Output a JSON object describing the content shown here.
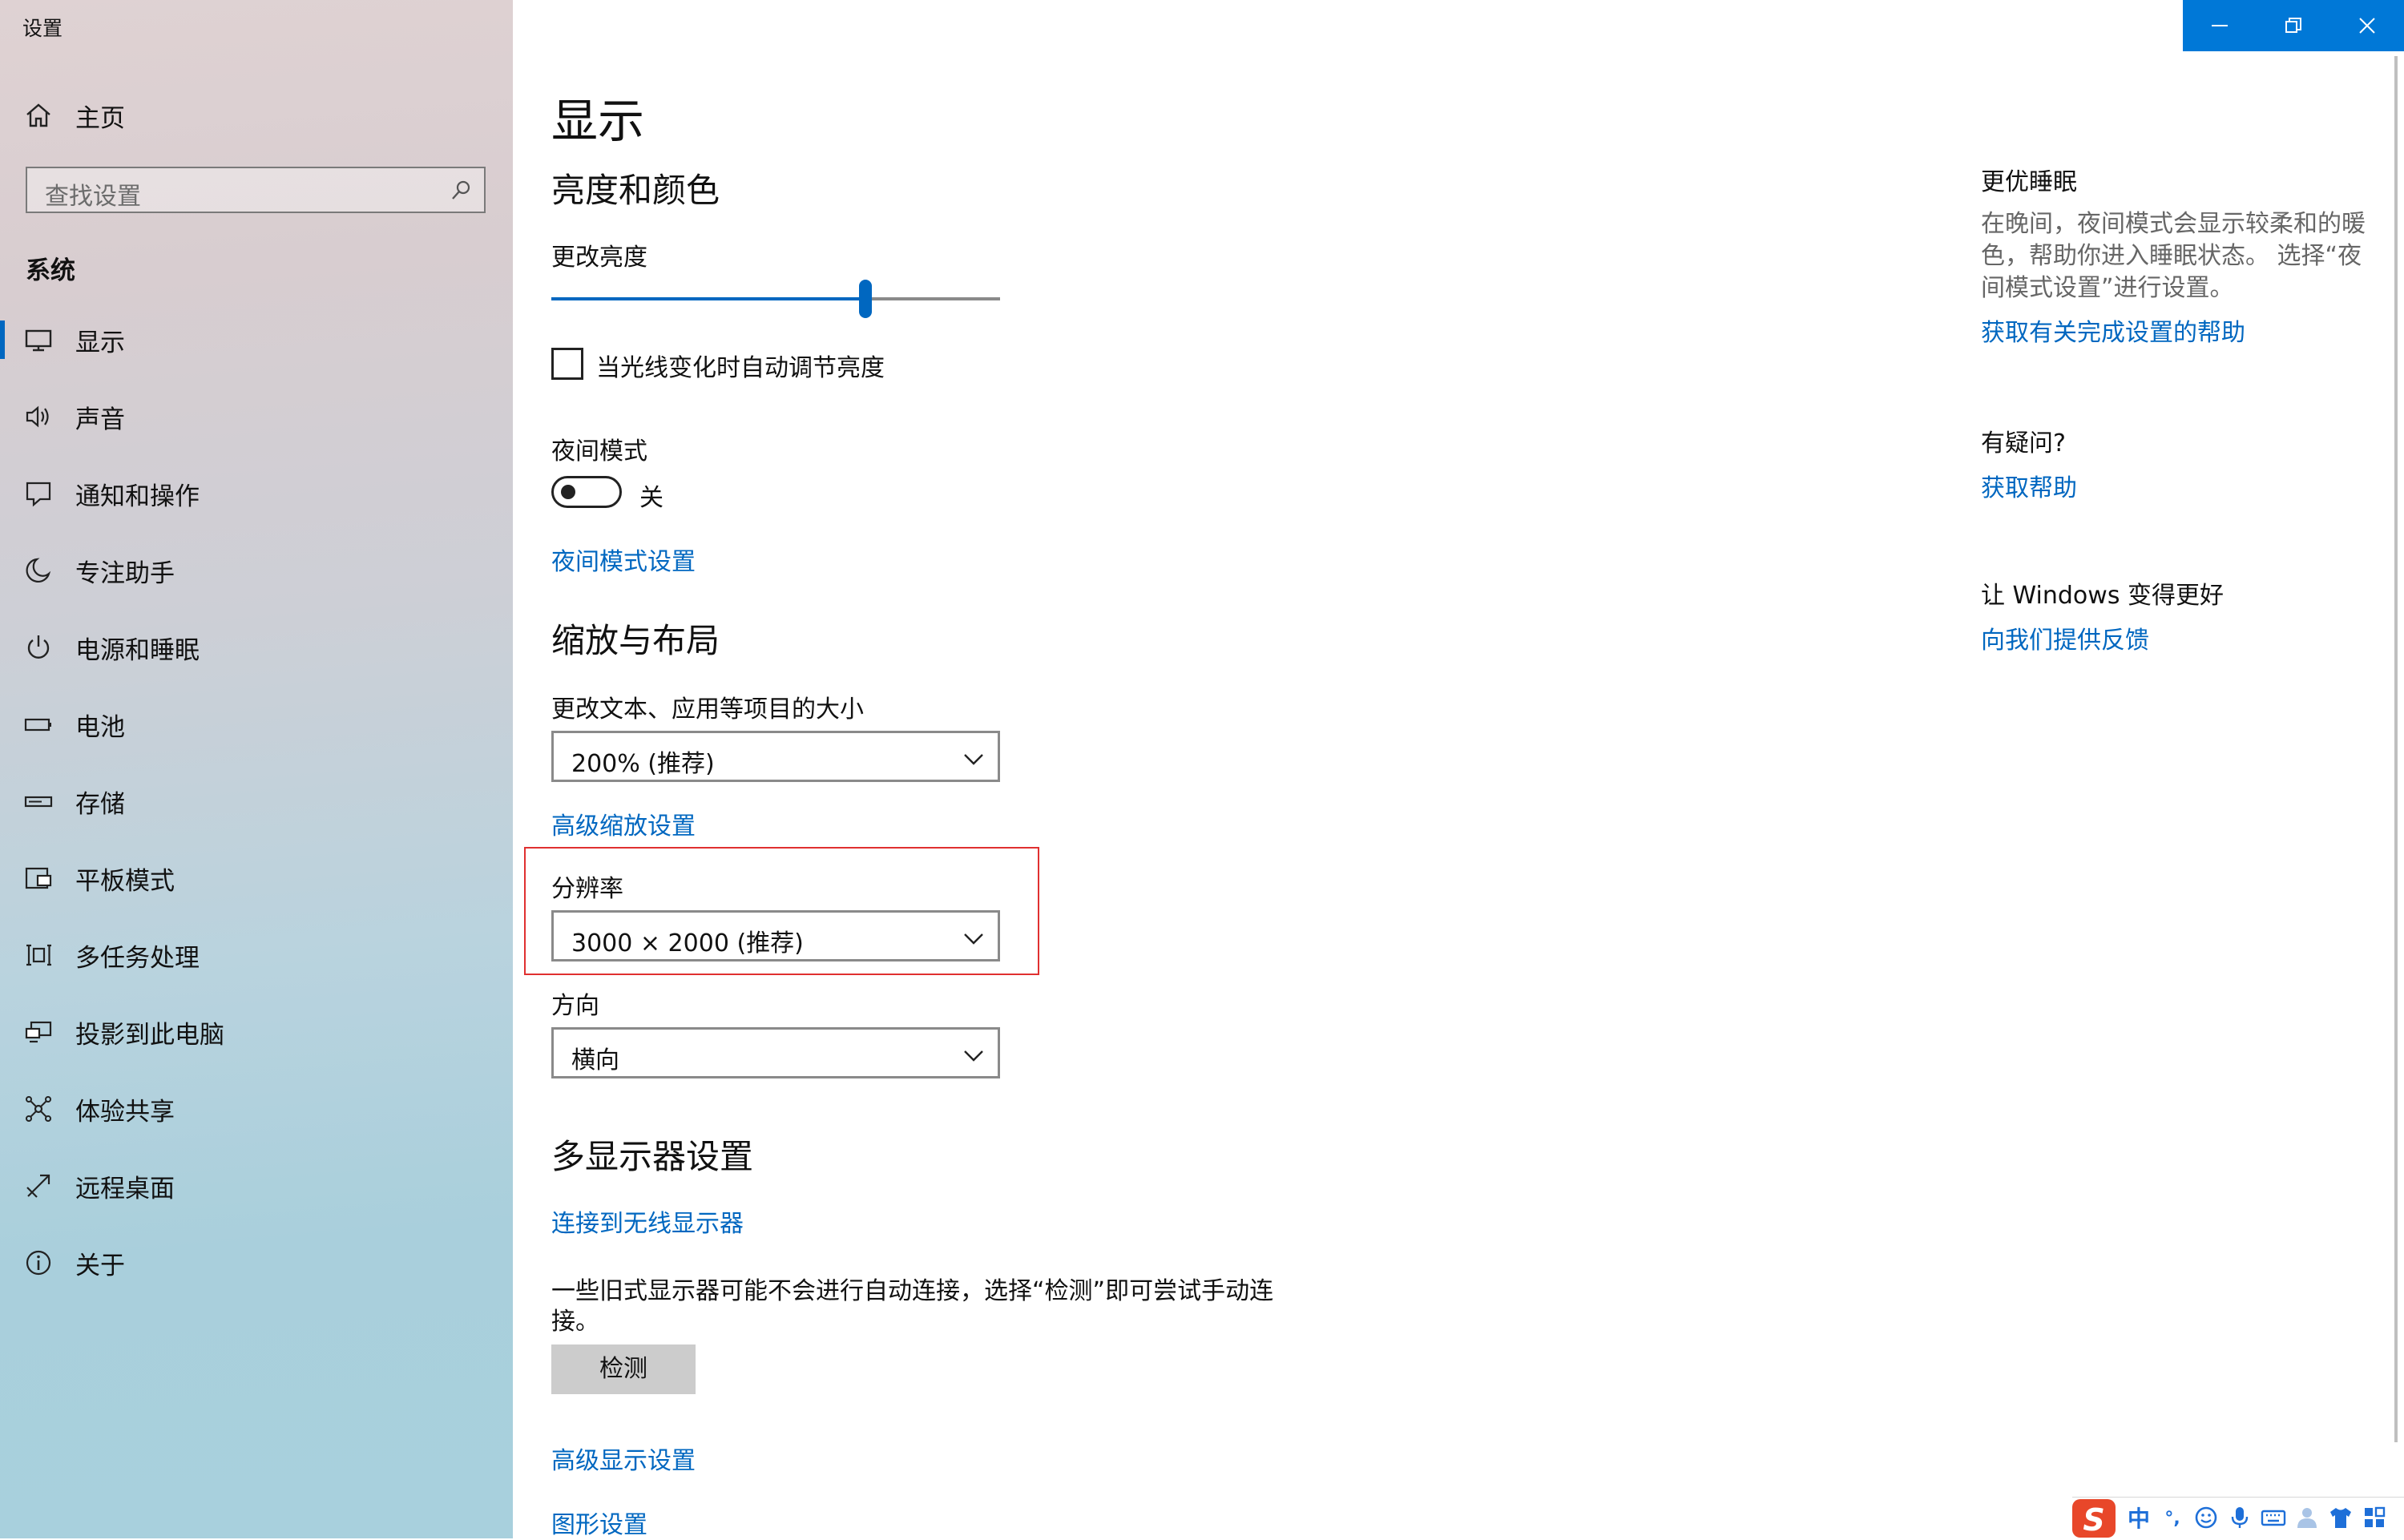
{
  "window": {
    "title": "设置",
    "controls": {
      "minimize": "minimize",
      "restore": "restore",
      "close": "close"
    }
  },
  "sidebar": {
    "home_label": "主页",
    "search_placeholder": "查找设置",
    "section_label": "系统",
    "items": [
      {
        "label": "显示",
        "icon": "monitor-icon",
        "active": true
      },
      {
        "label": "声音",
        "icon": "speaker-icon"
      },
      {
        "label": "通知和操作",
        "icon": "notification-icon"
      },
      {
        "label": "专注助手",
        "icon": "moon-icon"
      },
      {
        "label": "电源和睡眠",
        "icon": "power-icon"
      },
      {
        "label": "电池",
        "icon": "battery-icon"
      },
      {
        "label": "存储",
        "icon": "storage-icon"
      },
      {
        "label": "平板模式",
        "icon": "tablet-icon"
      },
      {
        "label": "多任务处理",
        "icon": "multitask-icon"
      },
      {
        "label": "投影到此电脑",
        "icon": "project-icon"
      },
      {
        "label": "体验共享",
        "icon": "share-icon"
      },
      {
        "label": "远程桌面",
        "icon": "remote-icon"
      },
      {
        "label": "关于",
        "icon": "info-icon"
      }
    ]
  },
  "main": {
    "title": "显示",
    "brightness": {
      "heading": "亮度和颜色",
      "slider_label": "更改亮度",
      "value_fraction": 0.7,
      "auto_label": "当光线变化时自动调节亮度",
      "auto_checked": false
    },
    "night": {
      "label": "夜间模式",
      "toggle_state": "关",
      "on": false,
      "settings_link": "夜间模式设置"
    },
    "scale": {
      "heading": "缩放与布局",
      "size_label": "更改文本、应用等项目的大小",
      "size_value": "200% (推荐)",
      "advanced_link": "高级缩放设置",
      "resolution_label": "分辨率",
      "resolution_value": "3000 × 2000 (推荐)",
      "orientation_label": "方向",
      "orientation_value": "横向"
    },
    "multi": {
      "heading": "多显示器设置",
      "wireless_link": "连接到无线显示器",
      "desc_line1": "一些旧式显示器可能不会进行自动连接，选择“检测”即可尝试手动连",
      "desc_line2": "接。",
      "detect_button": "检测",
      "advanced_link": "高级显示设置",
      "graphics_link": "图形设置"
    }
  },
  "right_panel": {
    "sleep_heading": "更优睡眠",
    "sleep_text": "在晚间，夜间模式会显示较柔和的暖色，帮助你进入睡眠状态。 选择“夜间模式设置”进行设置。",
    "sleep_link": "获取有关完成设置的帮助",
    "question_heading": "有疑问?",
    "help_link": "获取帮助",
    "better_heading": "让 Windows 变得更好",
    "feedback_link": "向我们提供反馈"
  },
  "ime": {
    "logo": "S",
    "mode": "中",
    "punct": "°,"
  },
  "colors": {
    "accent": "#0067c0",
    "titlebar_controls": "#0078d7",
    "highlight_box": "#e03030"
  }
}
